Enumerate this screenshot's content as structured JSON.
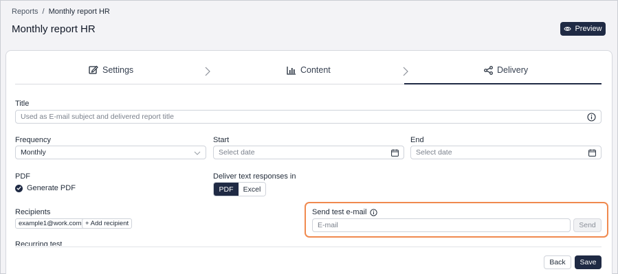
{
  "breadcrumb": {
    "root": "Reports",
    "separator": "/",
    "current": "Monthly report HR"
  },
  "page_title": "Monthly report HR",
  "preview_button": "Preview",
  "steps": [
    {
      "label": "Settings",
      "icon": "edit-icon"
    },
    {
      "label": "Content",
      "icon": "bar-chart-icon"
    },
    {
      "label": "Delivery",
      "icon": "share-icon",
      "active": true
    }
  ],
  "form": {
    "title_label": "Title",
    "title_placeholder": "Used as E-mail subject and delivered report title",
    "frequency_label": "Frequency",
    "frequency_value": "Monthly",
    "start_label": "Start",
    "start_placeholder": "Select date",
    "end_label": "End",
    "end_placeholder": "Select date",
    "pdf_label": "PDF",
    "generate_pdf_label": "Generate PDF",
    "generate_pdf_checked": true,
    "deliver_label": "Deliver text responses in",
    "deliver_options": [
      "PDF",
      "Excel"
    ],
    "deliver_selected": "PDF",
    "recipients_label": "Recipients",
    "recipient_chip": "example1@work.com",
    "add_recipient": "+ Add recipient",
    "test_email_label": "Send test e-mail",
    "email_placeholder": "E-mail",
    "send_button": "Send",
    "cut_label": "Recurring test"
  },
  "footer": {
    "back": "Back",
    "save": "Save"
  },
  "colors": {
    "primary": "#1f2a44",
    "highlight": "#f0894e"
  }
}
